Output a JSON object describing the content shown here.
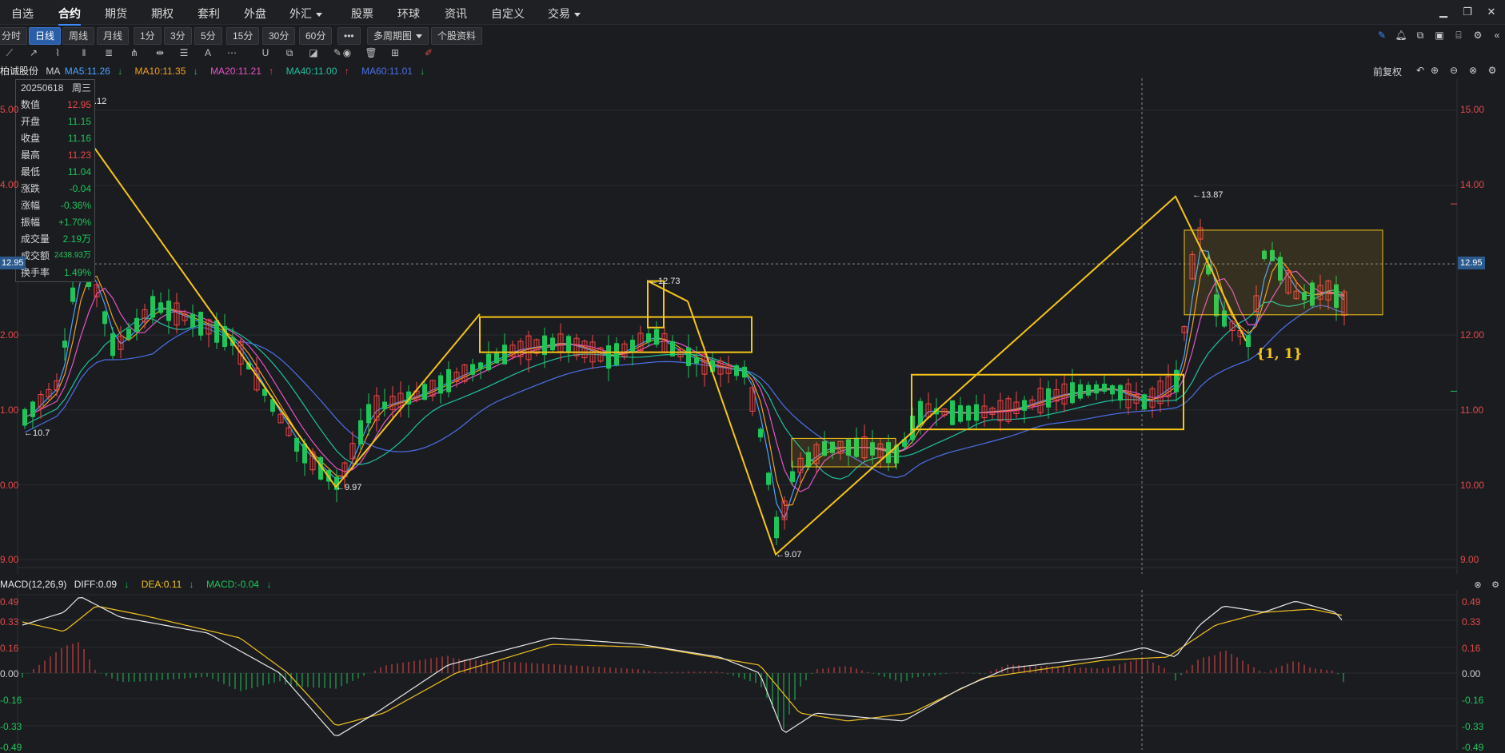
{
  "menu": {
    "items": [
      {
        "label": "自选",
        "caret": false,
        "active": false
      },
      {
        "label": "合约",
        "caret": false,
        "active": true
      },
      {
        "label": "期货",
        "caret": false,
        "active": false
      },
      {
        "label": "期权",
        "caret": false,
        "active": false
      },
      {
        "label": "套利",
        "caret": false,
        "active": false
      },
      {
        "label": "外盘",
        "caret": false,
        "active": false
      },
      {
        "label": "外汇",
        "caret": true,
        "active": false
      },
      {
        "label": "股票",
        "caret": false,
        "active": false
      },
      {
        "label": "环球",
        "caret": false,
        "active": false
      },
      {
        "label": "资讯",
        "caret": false,
        "active": false
      },
      {
        "label": "自定义",
        "caret": false,
        "active": false
      },
      {
        "label": "交易",
        "caret": true,
        "active": false
      }
    ]
  },
  "periods": {
    "buttons": [
      "分时",
      "日线",
      "周线",
      "月线",
      "1分",
      "3分",
      "5分",
      "15分",
      "30分",
      "60分",
      "•••",
      "多周期图",
      "个股资料"
    ],
    "selected": "日线"
  },
  "stock": {
    "name": "柏诚股份",
    "ma_label": "MA",
    "ma": [
      {
        "label": "MA5:11.26",
        "arrow": "↓",
        "color": "#4aa3ff"
      },
      {
        "label": "MA10:11.35",
        "arrow": "↓",
        "color": "#f0a020"
      },
      {
        "label": "MA20:11.21",
        "arrow": "↑",
        "color": "#e255c8"
      },
      {
        "label": "MA40:11.00",
        "arrow": "↑",
        "color": "#20c0a0"
      },
      {
        "label": "MA60:11.01",
        "arrow": "↓",
        "color": "#4a70e8"
      }
    ],
    "adjust_label": "前复权"
  },
  "info": {
    "date": "20250618",
    "weekday": "周三",
    "rows": [
      {
        "k": "数值",
        "v": "12.95",
        "c": "up"
      },
      {
        "k": "开盘",
        "v": "11.15",
        "c": "dn"
      },
      {
        "k": "收盘",
        "v": "11.16",
        "c": "dn"
      },
      {
        "k": "最高",
        "v": "11.23",
        "c": "up"
      },
      {
        "k": "最低",
        "v": "11.04",
        "c": "dn"
      },
      {
        "k": "涨跌",
        "v": "-0.04",
        "c": "dn"
      },
      {
        "k": "涨幅",
        "v": "-0.36%",
        "c": "dn"
      },
      {
        "k": "振幅",
        "v": "+1.70%",
        "c": "dn"
      },
      {
        "k": "成交量",
        "v": "2.19万",
        "c": "dn"
      },
      {
        "k": "成交额",
        "v": "2438.93万",
        "c": "dn"
      },
      {
        "k": "换手率",
        "v": "1.49%",
        "c": "dn"
      }
    ]
  },
  "axis": {
    "right": [
      "15.00",
      "14.00",
      "12.00",
      "11.00",
      "10.00",
      "9.00"
    ],
    "left": [
      "5.00",
      "4.00",
      "2.00",
      "1.00",
      "0.00",
      "9.00"
    ],
    "cursor_price": "12.95",
    "macd_right": [
      "0.49",
      "0.33",
      "0.16",
      "0.00",
      "-0.16",
      "-0.33",
      "-0.49"
    ],
    "macd_left": [
      "0.49",
      "0.33",
      "0.16",
      "0.00",
      "-0.16",
      "-0.33",
      "-0.49"
    ]
  },
  "annotations": {
    "low_left": "10.7",
    "low_1": "9.97",
    "high_mid": "12.73",
    "low_2": "9.07",
    "high_right": "13.87",
    "top_partial": ".12",
    "brace_label": "{1, 1}"
  },
  "macd": {
    "title": "MACD(12,26,9)",
    "diff": "DIFF:0.09",
    "diff_arrow": "↓",
    "dea": "DEA:0.11",
    "dea_arrow": "↓",
    "macd": "MACD:-0.04",
    "macd_arrow": "↓"
  },
  "colors": {
    "up": "#f04646",
    "down": "#1fc55a",
    "draw": "#f5c518",
    "ma5": "#4aa3ff",
    "ma10": "#f0a020",
    "ma20": "#e255c8",
    "ma40": "#20c0a0",
    "ma60": "#4a70e8"
  }
}
